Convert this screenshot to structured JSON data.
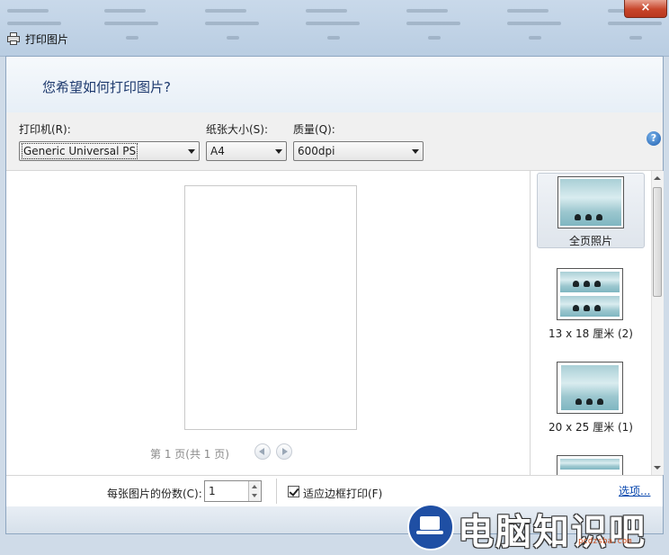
{
  "window": {
    "title": "打印图片",
    "close_label": "×"
  },
  "header": {
    "question": "您希望如何打印图片?"
  },
  "controls": {
    "printer_label": "打印机(R):",
    "printer_value": "Generic Universal PS",
    "paper_label": "纸张大小(S):",
    "paper_value": "A4",
    "quality_label": "质量(Q):",
    "quality_value": "600dpi",
    "help_label": "?"
  },
  "preview": {
    "page_info": "第 1 页(共 1 页)"
  },
  "layouts": [
    {
      "label": "全页照片",
      "selected": true
    },
    {
      "label": "13 x 18 厘米 (2)",
      "selected": false
    },
    {
      "label": "20 x 25 厘米 (1)",
      "selected": false
    }
  ],
  "footer": {
    "copies_label": "每张图片的份数(C):",
    "copies_value": "1",
    "fit_label": "适应边框打印(F)",
    "fit_checked": true,
    "options_link": "选项..."
  },
  "watermark": {
    "text": "电脑知识吧",
    "url": "pcdzsba.com"
  },
  "colors": {
    "header_text": "#1e3a6e",
    "link": "#0645ad",
    "close": "#c7452a"
  }
}
